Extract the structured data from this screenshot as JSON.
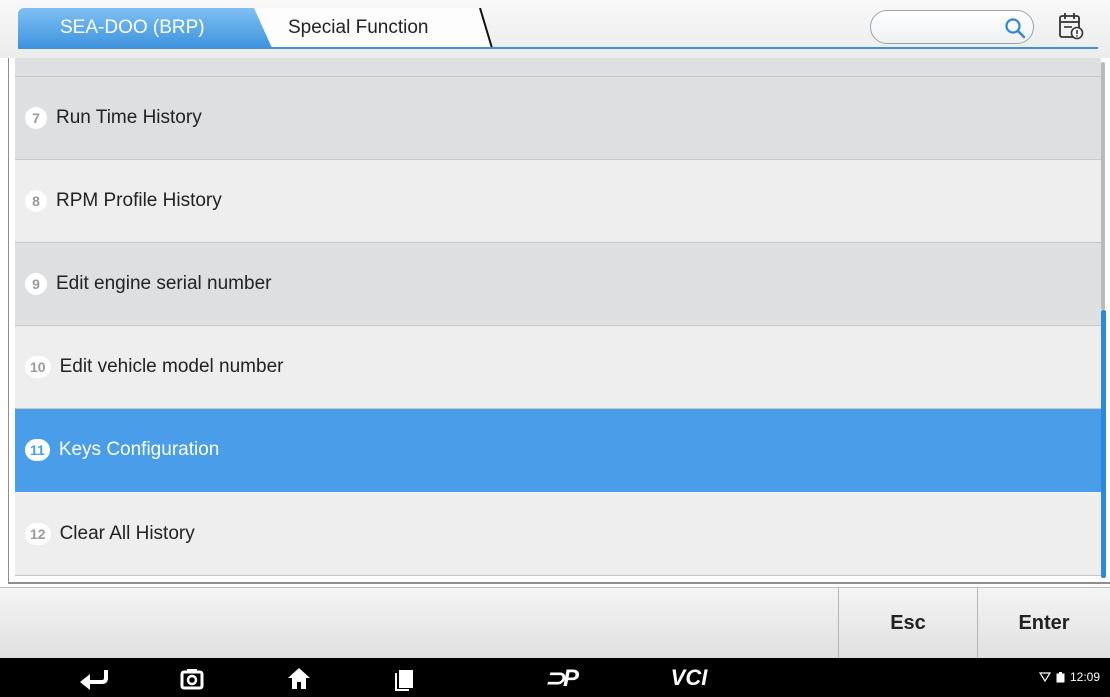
{
  "header": {
    "breadcrumb": [
      "SEA-DOO (BRP)",
      "Special Function"
    ],
    "search_placeholder": "",
    "accent": "#3e93de"
  },
  "list": {
    "items": [
      {
        "num": "7",
        "label": "Run Time History",
        "selected": false
      },
      {
        "num": "8",
        "label": "RPM Profile History",
        "selected": false
      },
      {
        "num": "9",
        "label": "Edit engine serial number",
        "selected": false
      },
      {
        "num": "10",
        "label": "Edit vehicle model number",
        "selected": false
      },
      {
        "num": "11",
        "label": "Keys Configuration",
        "selected": true
      },
      {
        "num": "12",
        "label": "Clear All History",
        "selected": false
      }
    ],
    "selected_color": "#4a9de8"
  },
  "actions": {
    "esc_label": "Esc",
    "enter_label": "Enter"
  },
  "navbar": {
    "icons": [
      "back-icon",
      "camera-icon",
      "home-icon",
      "recents-icon",
      "dp-logo-icon",
      "vci-icon"
    ],
    "vci_text": "VCI",
    "dp_text": "⊃P",
    "time": "12:09"
  }
}
